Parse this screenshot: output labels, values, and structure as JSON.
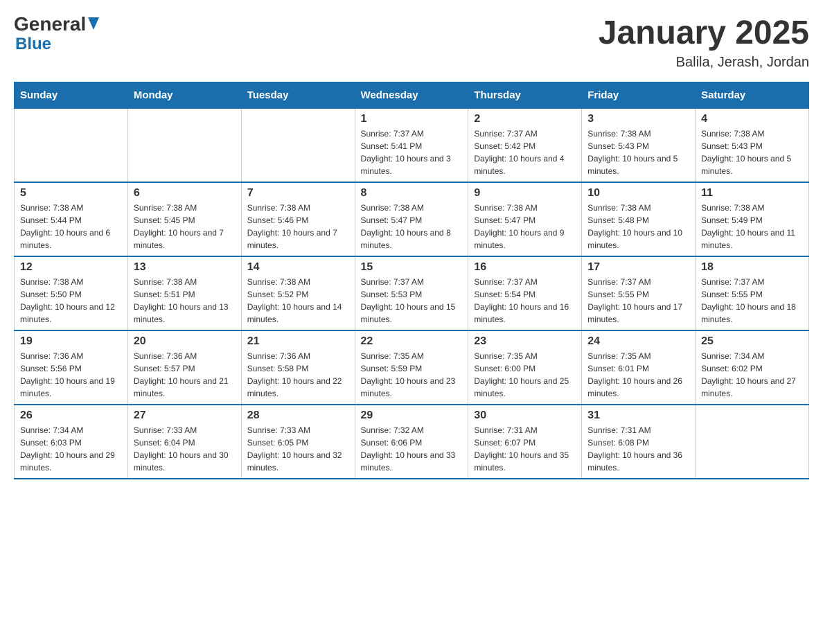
{
  "header": {
    "logo_general": "General",
    "logo_blue": "Blue",
    "title": "January 2025",
    "subtitle": "Balila, Jerash, Jordan"
  },
  "weekdays": [
    "Sunday",
    "Monday",
    "Tuesday",
    "Wednesday",
    "Thursday",
    "Friday",
    "Saturday"
  ],
  "weeks": [
    [
      {
        "day": "",
        "info": ""
      },
      {
        "day": "",
        "info": ""
      },
      {
        "day": "",
        "info": ""
      },
      {
        "day": "1",
        "info": "Sunrise: 7:37 AM\nSunset: 5:41 PM\nDaylight: 10 hours and 3 minutes."
      },
      {
        "day": "2",
        "info": "Sunrise: 7:37 AM\nSunset: 5:42 PM\nDaylight: 10 hours and 4 minutes."
      },
      {
        "day": "3",
        "info": "Sunrise: 7:38 AM\nSunset: 5:43 PM\nDaylight: 10 hours and 5 minutes."
      },
      {
        "day": "4",
        "info": "Sunrise: 7:38 AM\nSunset: 5:43 PM\nDaylight: 10 hours and 5 minutes."
      }
    ],
    [
      {
        "day": "5",
        "info": "Sunrise: 7:38 AM\nSunset: 5:44 PM\nDaylight: 10 hours and 6 minutes."
      },
      {
        "day": "6",
        "info": "Sunrise: 7:38 AM\nSunset: 5:45 PM\nDaylight: 10 hours and 7 minutes."
      },
      {
        "day": "7",
        "info": "Sunrise: 7:38 AM\nSunset: 5:46 PM\nDaylight: 10 hours and 7 minutes."
      },
      {
        "day": "8",
        "info": "Sunrise: 7:38 AM\nSunset: 5:47 PM\nDaylight: 10 hours and 8 minutes."
      },
      {
        "day": "9",
        "info": "Sunrise: 7:38 AM\nSunset: 5:47 PM\nDaylight: 10 hours and 9 minutes."
      },
      {
        "day": "10",
        "info": "Sunrise: 7:38 AM\nSunset: 5:48 PM\nDaylight: 10 hours and 10 minutes."
      },
      {
        "day": "11",
        "info": "Sunrise: 7:38 AM\nSunset: 5:49 PM\nDaylight: 10 hours and 11 minutes."
      }
    ],
    [
      {
        "day": "12",
        "info": "Sunrise: 7:38 AM\nSunset: 5:50 PM\nDaylight: 10 hours and 12 minutes."
      },
      {
        "day": "13",
        "info": "Sunrise: 7:38 AM\nSunset: 5:51 PM\nDaylight: 10 hours and 13 minutes."
      },
      {
        "day": "14",
        "info": "Sunrise: 7:38 AM\nSunset: 5:52 PM\nDaylight: 10 hours and 14 minutes."
      },
      {
        "day": "15",
        "info": "Sunrise: 7:37 AM\nSunset: 5:53 PM\nDaylight: 10 hours and 15 minutes."
      },
      {
        "day": "16",
        "info": "Sunrise: 7:37 AM\nSunset: 5:54 PM\nDaylight: 10 hours and 16 minutes."
      },
      {
        "day": "17",
        "info": "Sunrise: 7:37 AM\nSunset: 5:55 PM\nDaylight: 10 hours and 17 minutes."
      },
      {
        "day": "18",
        "info": "Sunrise: 7:37 AM\nSunset: 5:55 PM\nDaylight: 10 hours and 18 minutes."
      }
    ],
    [
      {
        "day": "19",
        "info": "Sunrise: 7:36 AM\nSunset: 5:56 PM\nDaylight: 10 hours and 19 minutes."
      },
      {
        "day": "20",
        "info": "Sunrise: 7:36 AM\nSunset: 5:57 PM\nDaylight: 10 hours and 21 minutes."
      },
      {
        "day": "21",
        "info": "Sunrise: 7:36 AM\nSunset: 5:58 PM\nDaylight: 10 hours and 22 minutes."
      },
      {
        "day": "22",
        "info": "Sunrise: 7:35 AM\nSunset: 5:59 PM\nDaylight: 10 hours and 23 minutes."
      },
      {
        "day": "23",
        "info": "Sunrise: 7:35 AM\nSunset: 6:00 PM\nDaylight: 10 hours and 25 minutes."
      },
      {
        "day": "24",
        "info": "Sunrise: 7:35 AM\nSunset: 6:01 PM\nDaylight: 10 hours and 26 minutes."
      },
      {
        "day": "25",
        "info": "Sunrise: 7:34 AM\nSunset: 6:02 PM\nDaylight: 10 hours and 27 minutes."
      }
    ],
    [
      {
        "day": "26",
        "info": "Sunrise: 7:34 AM\nSunset: 6:03 PM\nDaylight: 10 hours and 29 minutes."
      },
      {
        "day": "27",
        "info": "Sunrise: 7:33 AM\nSunset: 6:04 PM\nDaylight: 10 hours and 30 minutes."
      },
      {
        "day": "28",
        "info": "Sunrise: 7:33 AM\nSunset: 6:05 PM\nDaylight: 10 hours and 32 minutes."
      },
      {
        "day": "29",
        "info": "Sunrise: 7:32 AM\nSunset: 6:06 PM\nDaylight: 10 hours and 33 minutes."
      },
      {
        "day": "30",
        "info": "Sunrise: 7:31 AM\nSunset: 6:07 PM\nDaylight: 10 hours and 35 minutes."
      },
      {
        "day": "31",
        "info": "Sunrise: 7:31 AM\nSunset: 6:08 PM\nDaylight: 10 hours and 36 minutes."
      },
      {
        "day": "",
        "info": ""
      }
    ]
  ]
}
